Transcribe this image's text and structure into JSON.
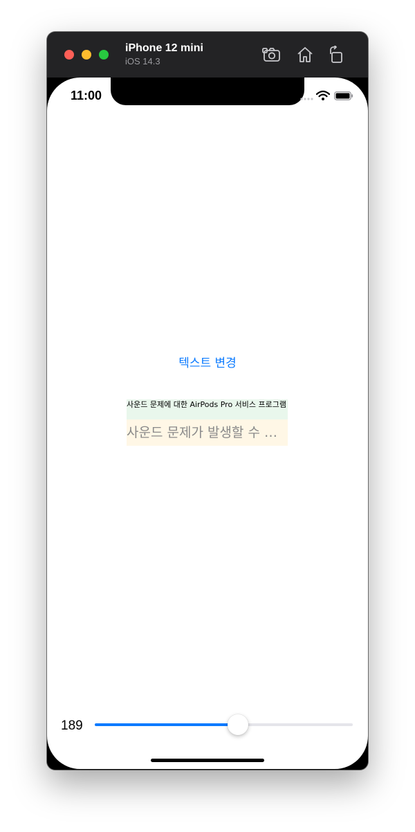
{
  "simulator": {
    "device_name": "iPhone 12 mini",
    "os_version": "iOS 14.3",
    "toolbar_icons": [
      "screenshot-icon",
      "home-icon",
      "rotate-icon"
    ]
  },
  "status_bar": {
    "time": "11:00"
  },
  "app": {
    "change_text_button": "텍스트 변경",
    "small_label_text": "사운드 문제에 대한 AirPods Pro 서비스 프로그램",
    "large_label_text": "사운드 문제가 발생할 수 있는 AirPods Pro",
    "slider": {
      "value_label": "189",
      "fill_fraction": 0.556
    }
  },
  "colors": {
    "accent": "#0a7aff",
    "small_label_bg": "#e9f7ec",
    "large_label_bg": "#fff7e6"
  }
}
